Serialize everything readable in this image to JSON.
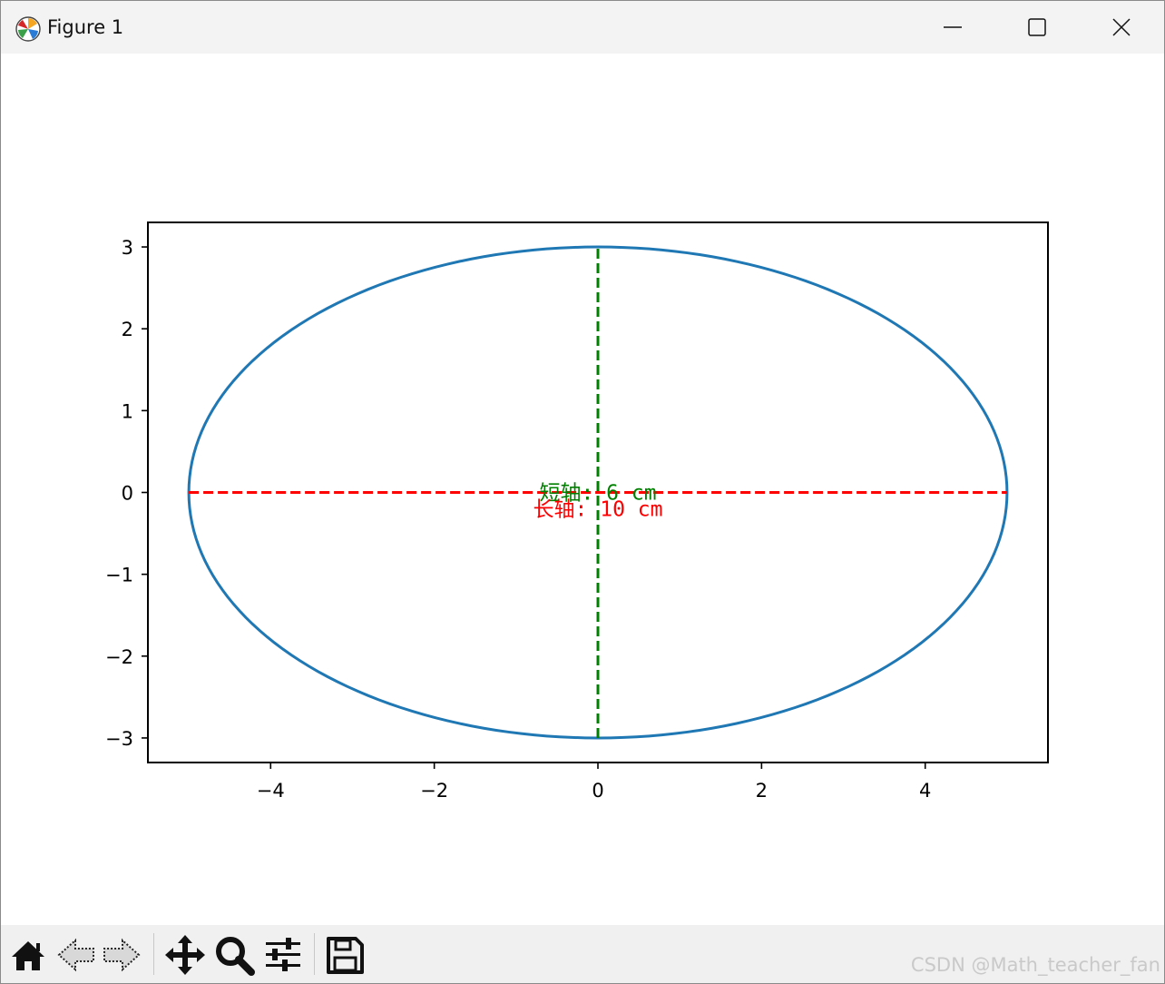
{
  "window": {
    "title": "Figure 1",
    "controls": {
      "minimize_icon": "minimize-icon",
      "maximize_icon": "maximize-icon",
      "close_icon": "close-icon"
    }
  },
  "toolbar": {
    "buttons": [
      {
        "icon": "home-icon"
      },
      {
        "icon": "back-arrow-icon"
      },
      {
        "icon": "forward-arrow-icon"
      },
      {
        "icon": "pan-move-icon"
      },
      {
        "icon": "zoom-magnifier-icon"
      },
      {
        "icon": "subplots-sliders-icon"
      },
      {
        "icon": "save-floppy-icon"
      }
    ]
  },
  "watermark": "CSDN @Math_teacher_fan",
  "chart_data": {
    "type": "line",
    "xlim": [
      -5.5,
      5.5
    ],
    "ylim": [
      -3.3,
      3.3
    ],
    "xticks": [
      -4,
      -2,
      0,
      2,
      4
    ],
    "xtick_labels": [
      "−4",
      "−2",
      "0",
      "2",
      "4"
    ],
    "yticks": [
      -3,
      -2,
      -1,
      0,
      1,
      2,
      3
    ],
    "ytick_labels": [
      "−3",
      "−2",
      "−1",
      "0",
      "1",
      "2",
      "3"
    ],
    "grid": false,
    "ellipse": {
      "a": 5,
      "b": 3,
      "color": "#1f77b4"
    },
    "lines": [
      {
        "x": [
          -5,
          5
        ],
        "y": [
          0,
          0
        ],
        "color": "#ff0000",
        "style": "dashed"
      },
      {
        "x": [
          0,
          0
        ],
        "y": [
          -3,
          3
        ],
        "color": "#008000",
        "style": "dashed"
      }
    ],
    "annotations": [
      {
        "text": "短轴: 6 cm",
        "x": 0,
        "y": 0,
        "color": "#008000"
      },
      {
        "text": "长轴: 10 cm",
        "x": 0,
        "y": -0.2,
        "color": "#ff0000"
      }
    ]
  }
}
